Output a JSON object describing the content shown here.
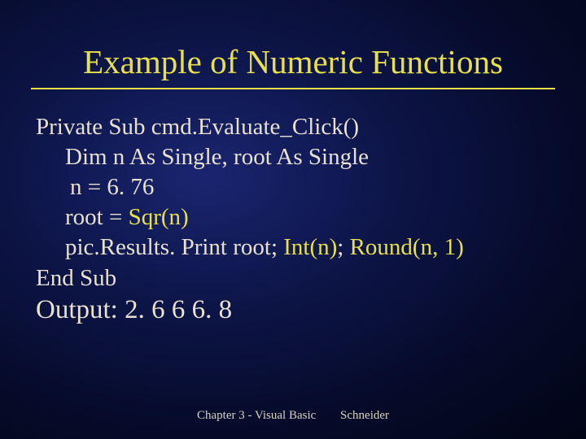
{
  "title": "Example of Numeric Functions",
  "code": {
    "l1": "Private Sub cmd.Evaluate_Click()",
    "l2": "Dim n As Single, root As Single",
    "l3": "n = 6. 76",
    "l4a": "root = ",
    "l4b": "Sqr(n)",
    "l5a": "pic.Results. Print  root; ",
    "l5b": "Int(n)",
    "l5c": "; ",
    "l5d": "Round(n, 1)",
    "l6": "End Sub"
  },
  "output_label": "Output:",
  "output_values": "2. 6   6   6. 8",
  "footer_left": "Chapter 3 - Visual Basic",
  "footer_right": "Schneider"
}
